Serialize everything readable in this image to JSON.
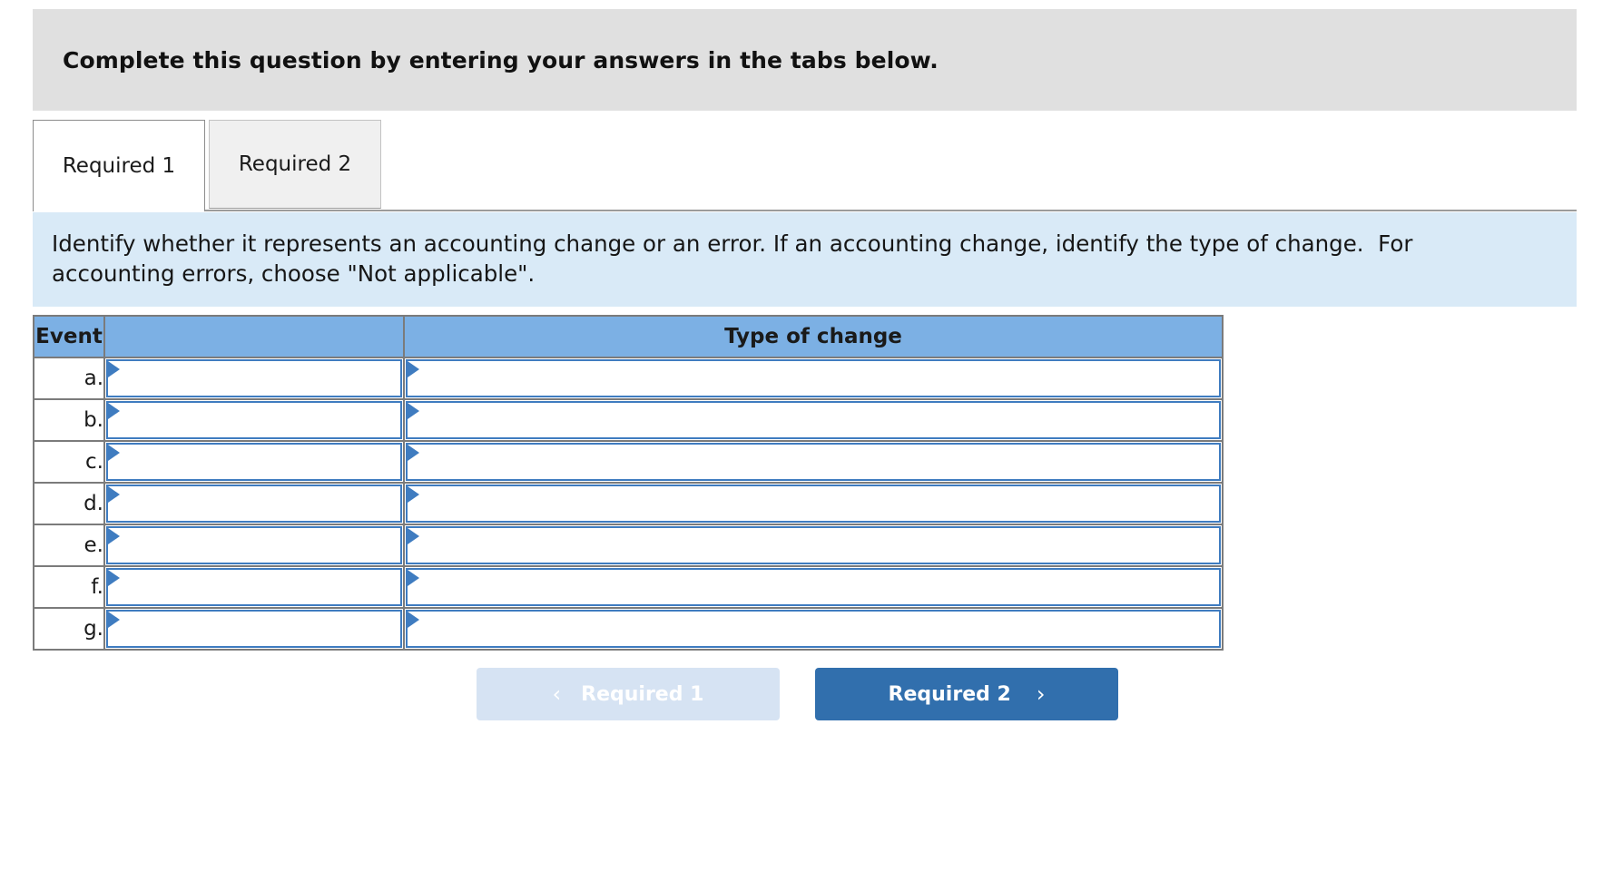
{
  "banner": {
    "text": "Complete this question by entering your answers in the tabs below."
  },
  "tabs": [
    {
      "label": "Required 1",
      "active": true
    },
    {
      "label": "Required 2",
      "active": false
    }
  ],
  "prompt": {
    "line1": "Identify whether it represents an accounting change or an error. If an accounting change, identify the type of change.  For",
    "line2": "accounting errors, choose \"Not applicable\"."
  },
  "table": {
    "headers": {
      "event": "Event",
      "blank": "",
      "type_of_change": "Type of change"
    },
    "rows": [
      {
        "event": "a.",
        "change_value": "",
        "type_value": ""
      },
      {
        "event": "b.",
        "change_value": "",
        "type_value": ""
      },
      {
        "event": "c.",
        "change_value": "",
        "type_value": ""
      },
      {
        "event": "d.",
        "change_value": "",
        "type_value": ""
      },
      {
        "event": "e.",
        "change_value": "",
        "type_value": ""
      },
      {
        "event": "f.",
        "change_value": "",
        "type_value": ""
      },
      {
        "event": "g.",
        "change_value": "",
        "type_value": ""
      }
    ]
  },
  "nav": {
    "prev_label": "Required 1",
    "next_label": "Required 2",
    "prev_chevron": "‹",
    "next_chevron": "›"
  },
  "colors": {
    "banner_bg": "#e0e0e0",
    "prompt_bg": "#d9eaf7",
    "header_bg": "#7cb0e4",
    "dropdown_border": "#3f7cc0",
    "next_btn_bg": "#316fad",
    "prev_btn_bg": "#d6e3f3"
  }
}
